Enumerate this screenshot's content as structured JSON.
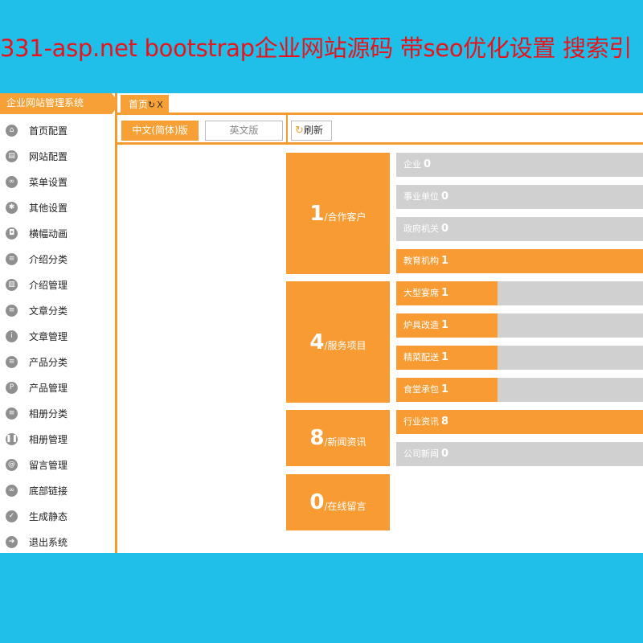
{
  "banner": "331-asp.net bootstrap企业网站源码 带seo优化设置 搜索引",
  "sidebar": {
    "title": "企业网站管理系统",
    "items": [
      {
        "label": "首页配置",
        "icon": "home-icon",
        "glyph": "⌂"
      },
      {
        "label": "网站配置",
        "icon": "window-icon",
        "glyph": "▤"
      },
      {
        "label": "菜单设置",
        "icon": "link-icon",
        "glyph": "∞"
      },
      {
        "label": "其他设置",
        "icon": "gear-icon",
        "glyph": "✱"
      },
      {
        "label": "横幅动画",
        "icon": "image-icon",
        "glyph": "◘"
      },
      {
        "label": "介绍分类",
        "icon": "list-icon",
        "glyph": "≡"
      },
      {
        "label": "介绍管理",
        "icon": "document-icon",
        "glyph": "▥"
      },
      {
        "label": "文章分类",
        "icon": "list-icon",
        "glyph": "≡"
      },
      {
        "label": "文章管理",
        "icon": "article-icon",
        "glyph": "ⅰ"
      },
      {
        "label": "产品分类",
        "icon": "list-icon",
        "glyph": "≡"
      },
      {
        "label": "产品管理",
        "icon": "product-icon",
        "glyph": "P"
      },
      {
        "label": "相册分类",
        "icon": "list-icon",
        "glyph": "≡"
      },
      {
        "label": "相册管理",
        "icon": "album-icon",
        "glyph": "❚❚"
      },
      {
        "label": "留言管理",
        "icon": "at-icon",
        "glyph": "@"
      },
      {
        "label": "底部链接",
        "icon": "link-icon",
        "glyph": "∞"
      },
      {
        "label": "生成静态",
        "icon": "check-icon",
        "glyph": "✓"
      },
      {
        "label": "退出系统",
        "icon": "exit-arrow-icon",
        "glyph": "➜"
      }
    ]
  },
  "tabs": {
    "home_label": "首页",
    "refresh_glyph": "↻",
    "close_glyph": "X"
  },
  "toolbar": {
    "lang_cn": "中文(简体)版",
    "lang_en": "英文版",
    "refresh_label": "刷新",
    "refresh_glyph": "↻"
  },
  "stats": [
    {
      "number": "1",
      "label": "/合作客户"
    },
    {
      "number": "4",
      "label": "/服务项目"
    },
    {
      "number": "8",
      "label": "/新闻资讯"
    },
    {
      "number": "0",
      "label": "/在线留言"
    }
  ],
  "groups": [
    [
      {
        "label": "企业",
        "value": "0",
        "fill": 0
      },
      {
        "label": "事业单位",
        "value": "0",
        "fill": 0
      },
      {
        "label": "政府机关",
        "value": "0",
        "fill": 0
      },
      {
        "label": "教育机构",
        "value": "1",
        "fill": 1
      }
    ],
    [
      {
        "label": "大型宴席",
        "value": "1",
        "fill": 0.41
      },
      {
        "label": "炉具改造",
        "value": "1",
        "fill": 0.41
      },
      {
        "label": "精菜配送",
        "value": "1",
        "fill": 0.41
      },
      {
        "label": "食堂承包",
        "value": "1",
        "fill": 0.41
      }
    ],
    [
      {
        "label": "行业资讯",
        "value": "8",
        "fill": 1
      },
      {
        "label": "公司新闻",
        "value": "0",
        "fill": 0
      }
    ]
  ],
  "colors": {
    "accent": "#f89b32",
    "bar_bg": "#d0d0d0",
    "page_bg": "#1fbfea",
    "banner_text": "#e8141c"
  }
}
